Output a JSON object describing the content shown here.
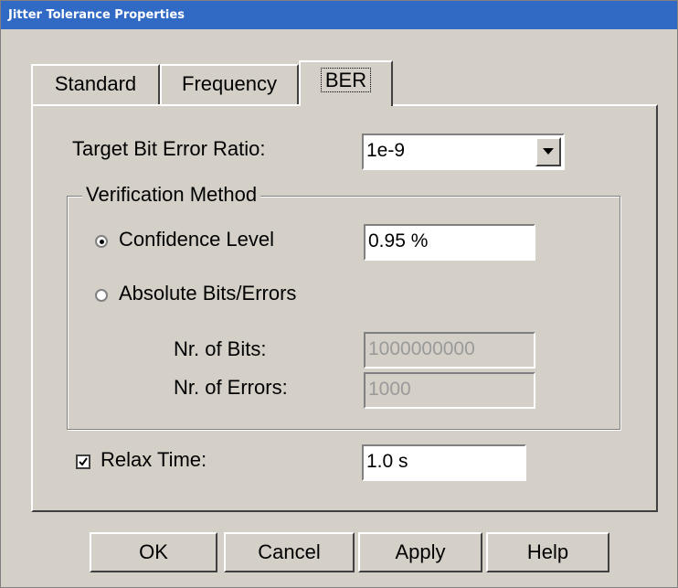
{
  "window": {
    "title": "Jitter Tolerance Properties"
  },
  "tabs": [
    {
      "label": "Standard",
      "active": false
    },
    {
      "label": "Frequency",
      "active": false
    },
    {
      "label": "BER",
      "active": true
    }
  ],
  "ber": {
    "target_label": "Target Bit Error Ratio:",
    "target_value": "1e-9",
    "verification": {
      "title": "Verification Method",
      "confidence_label": "Confidence Level",
      "confidence_value": "0.95 %",
      "confidence_selected": true,
      "absolute_label": "Absolute Bits/Errors",
      "absolute_selected": false,
      "bits_label": "Nr. of Bits:",
      "bits_value": "1000000000",
      "errors_label": "Nr. of Errors:",
      "errors_value": "1000"
    },
    "relax_label": "Relax Time:",
    "relax_checked": true,
    "relax_value": "1.0 s"
  },
  "buttons": {
    "ok": "OK",
    "cancel": "Cancel",
    "apply": "Apply",
    "help": "Help"
  },
  "colors": {
    "face": "#d4d0c8",
    "titlebar": "#316ac5",
    "disabled_text": "#9a9a9a"
  }
}
